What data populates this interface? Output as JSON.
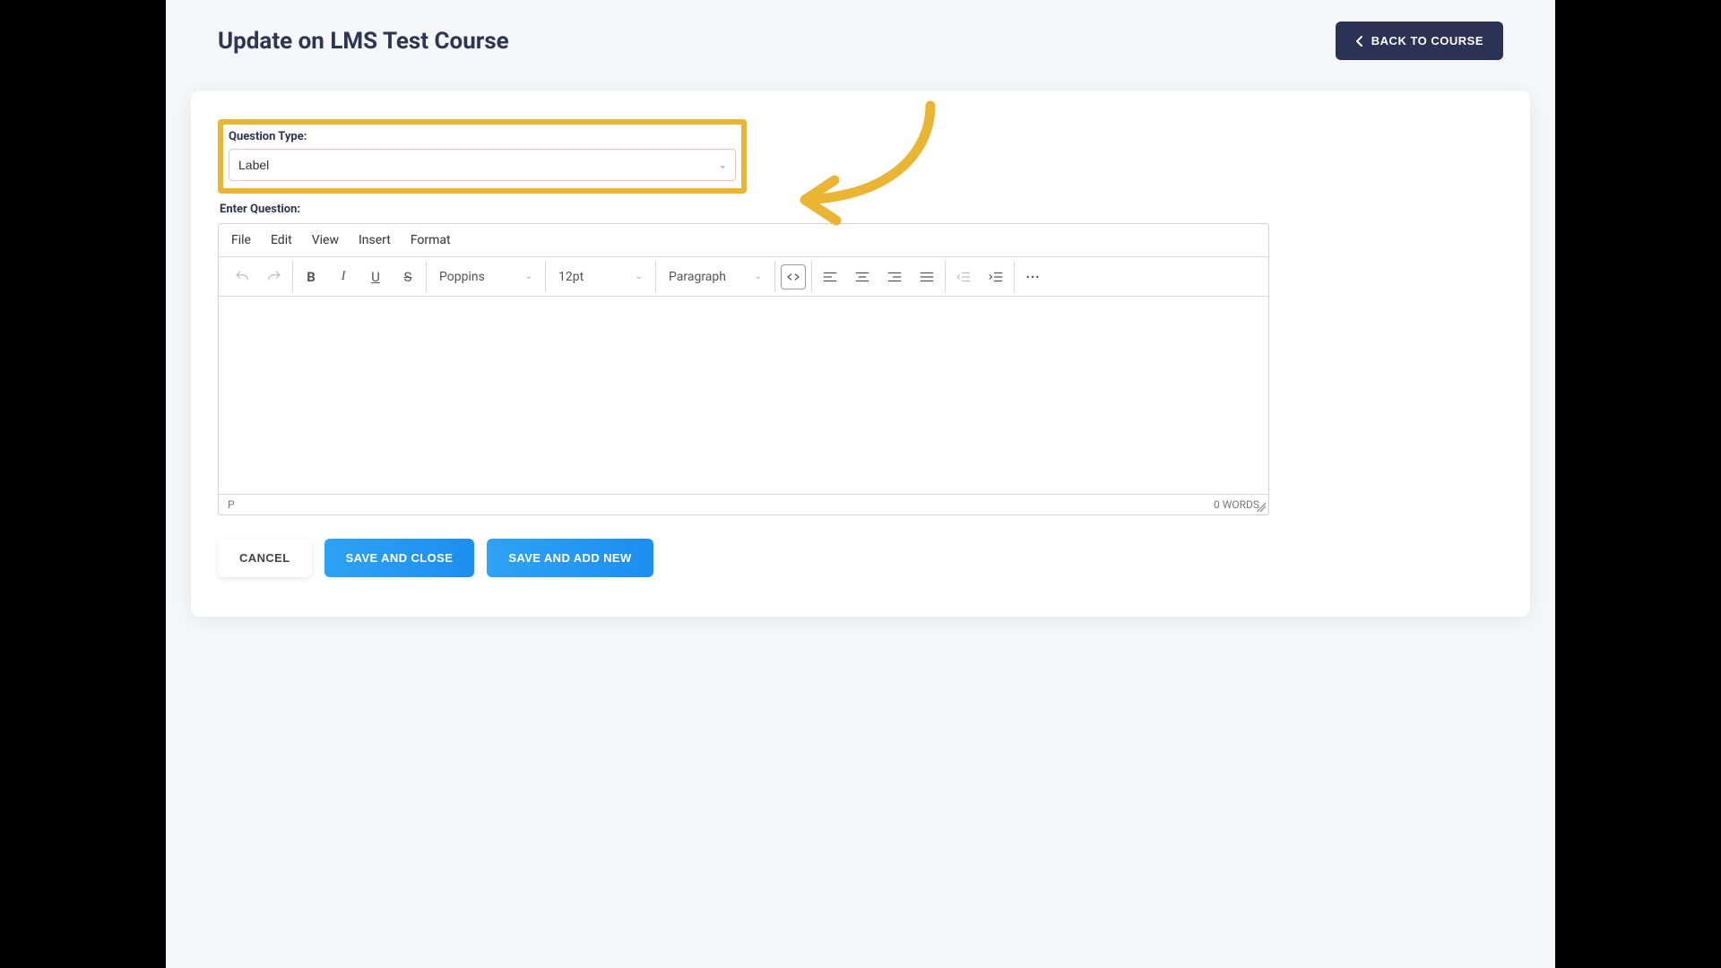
{
  "header": {
    "title": "Update on LMS Test Course",
    "back_label": "BACK TO COURSE"
  },
  "form": {
    "question_type_label": "Question Type:",
    "question_type_value": "Label",
    "enter_question_label": "Enter Question:"
  },
  "editor": {
    "menu": {
      "file": "File",
      "edit": "Edit",
      "view": "View",
      "insert": "Insert",
      "format": "Format"
    },
    "font_family": "Poppins",
    "font_size": "12pt",
    "block_format": "Paragraph",
    "path_indicator": "P",
    "word_count": "0 WORDS"
  },
  "buttons": {
    "cancel": "CANCEL",
    "save_close": "SAVE AND CLOSE",
    "save_add_new": "SAVE AND ADD NEW"
  }
}
